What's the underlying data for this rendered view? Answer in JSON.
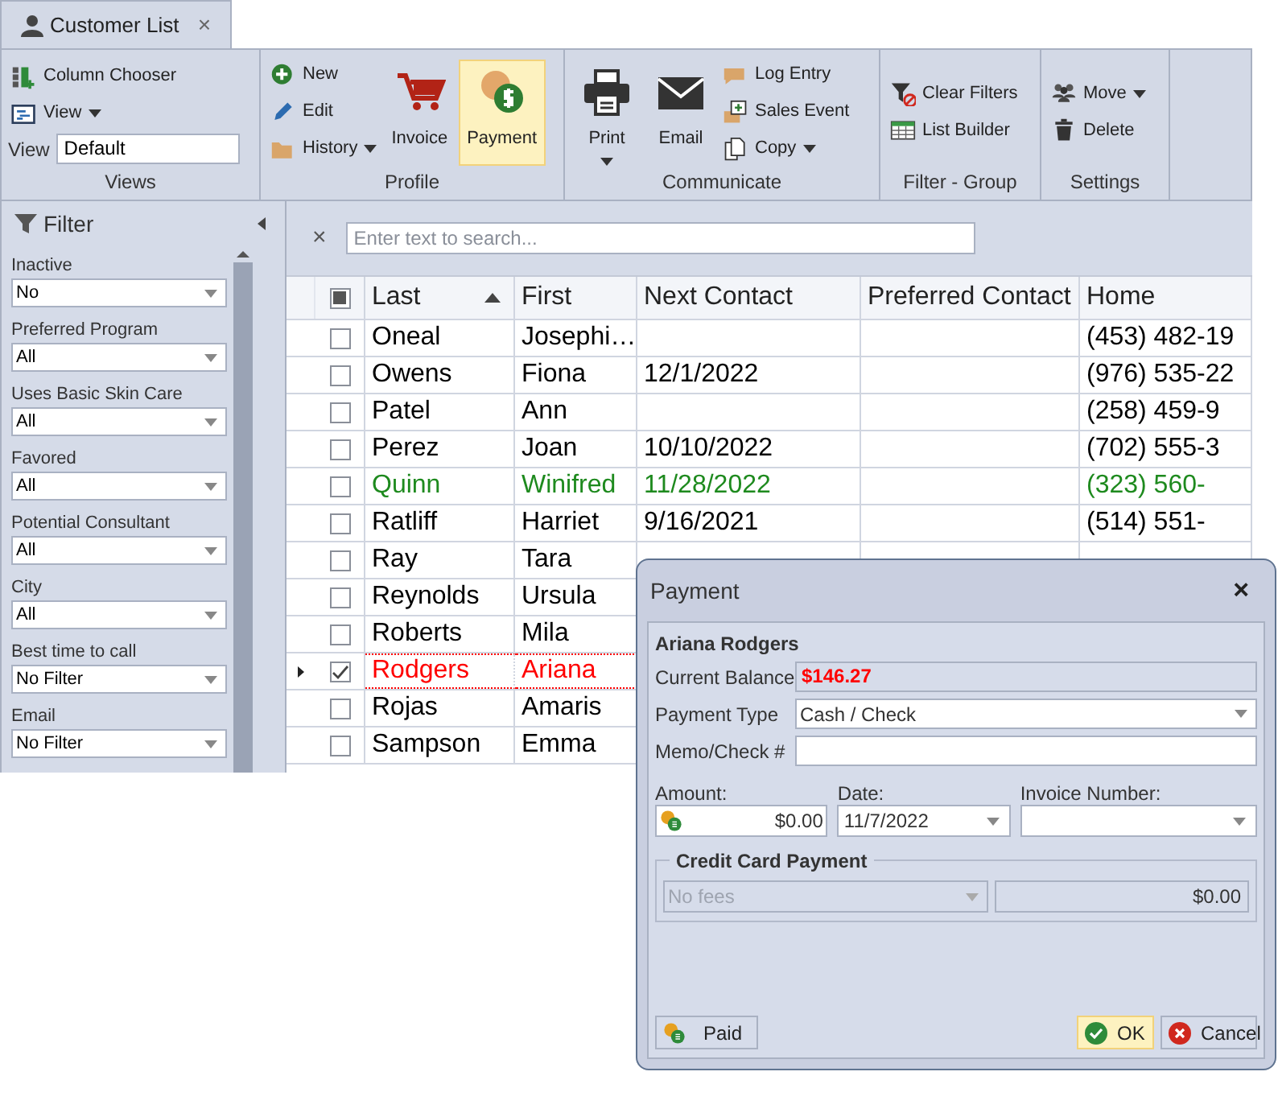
{
  "tab": {
    "title": "Customer List",
    "close": "×"
  },
  "ribbon": {
    "groups": [
      {
        "label": "Views",
        "columns": [
          [
            {
              "kind": "small",
              "label": "Column Chooser",
              "dropdown": false,
              "selected": false
            },
            {
              "kind": "small",
              "label": "View",
              "dropdown": true,
              "selected": false
            },
            {
              "kind": "field",
              "label": "View",
              "value": "Default"
            }
          ]
        ]
      },
      {
        "label": "Profile",
        "columns": [
          [
            {
              "kind": "small",
              "label": "New",
              "dropdown": false,
              "selected": false
            },
            {
              "kind": "small",
              "label": "Edit",
              "dropdown": false,
              "selected": false
            },
            {
              "kind": "small",
              "label": "History",
              "dropdown": true,
              "selected": false
            }
          ],
          [
            {
              "kind": "large",
              "label": "Invoice",
              "dropdown": false,
              "selected": false
            }
          ],
          [
            {
              "kind": "large",
              "label": "Payment",
              "dropdown": false,
              "selected": true
            }
          ]
        ]
      },
      {
        "label": "Communicate",
        "columns": [
          [
            {
              "kind": "large",
              "label": "Print",
              "dropdown": true,
              "selected": false
            }
          ],
          [
            {
              "kind": "large",
              "label": "Email",
              "dropdown": false,
              "selected": false
            }
          ],
          [
            {
              "kind": "small",
              "label": "Log Entry",
              "dropdown": false,
              "selected": false
            },
            {
              "kind": "small",
              "label": "Sales Event",
              "dropdown": false,
              "selected": false
            },
            {
              "kind": "small",
              "label": "Copy",
              "dropdown": true,
              "selected": false
            }
          ]
        ]
      },
      {
        "label": "Filter - Group",
        "columns": [
          [
            {
              "kind": "small",
              "label": "Clear Filters",
              "dropdown": false,
              "selected": false
            },
            {
              "kind": "small",
              "label": "List Builder",
              "dropdown": false,
              "selected": false
            }
          ]
        ]
      },
      {
        "label": "Settings",
        "columns": [
          [
            {
              "kind": "small",
              "label": "Move",
              "dropdown": true,
              "selected": false
            },
            {
              "kind": "small",
              "label": "Delete",
              "dropdown": false,
              "selected": false
            }
          ]
        ]
      }
    ]
  },
  "filter": {
    "title": "Filter",
    "filters": [
      {
        "label": "Inactive",
        "value": "No"
      },
      {
        "label": "Preferred Program",
        "value": "All"
      },
      {
        "label": "Uses Basic Skin Care",
        "value": "All"
      },
      {
        "label": "Favored",
        "value": "All"
      },
      {
        "label": "Potential Consultant",
        "value": "All"
      },
      {
        "label": "City",
        "value": "All"
      },
      {
        "label": "Best time to call",
        "value": "No Filter"
      },
      {
        "label": "Email",
        "value": "No Filter"
      }
    ]
  },
  "grid": {
    "search": {
      "clear": "×",
      "placeholder": "Enter text to search..."
    },
    "select_all": {
      "indeterminate": true
    },
    "columns": [
      {
        "label": "Last",
        "sorted": true
      },
      {
        "label": "First",
        "sorted": false
      },
      {
        "label": "Next Contact",
        "sorted": false
      },
      {
        "label": "Preferred Contact",
        "sorted": false
      },
      {
        "label": "Home",
        "sorted": false
      }
    ],
    "rows": [
      {
        "cells": [
          "Oneal",
          "Josephi…",
          "",
          "",
          "(453) 482-19"
        ],
        "checked": false,
        "selected": false,
        "color": "#000000"
      },
      {
        "cells": [
          "Owens",
          "Fiona",
          "12/1/2022",
          "",
          "(976) 535-22"
        ],
        "checked": false,
        "selected": false,
        "color": "#000000"
      },
      {
        "cells": [
          "Patel",
          "Ann",
          "",
          "",
          "(258) 459-9"
        ],
        "checked": false,
        "selected": false,
        "color": "#000000"
      },
      {
        "cells": [
          "Perez",
          "Joan",
          "10/10/2022",
          "",
          "(702) 555-3"
        ],
        "checked": false,
        "selected": false,
        "color": "#000000"
      },
      {
        "cells": [
          "Quinn",
          "Winifred",
          "11/28/2022",
          "",
          "(323) 560-"
        ],
        "checked": false,
        "selected": false,
        "color": "#1e8a1e"
      },
      {
        "cells": [
          "Ratliff",
          "Harriet",
          "9/16/2021",
          "",
          "(514) 551-"
        ],
        "checked": false,
        "selected": false,
        "color": "#000000"
      },
      {
        "cells": [
          "Ray",
          "Tara"
        ],
        "checked": false,
        "selected": false,
        "color": "#000000"
      },
      {
        "cells": [
          "Reynolds",
          "Ursula"
        ],
        "checked": false,
        "selected": false,
        "color": "#000000"
      },
      {
        "cells": [
          "Roberts",
          "Mila"
        ],
        "checked": false,
        "selected": false,
        "color": "#000000"
      },
      {
        "cells": [
          "Rodgers",
          "Ariana"
        ],
        "checked": true,
        "selected": true,
        "color": "#ff0000"
      },
      {
        "cells": [
          "Rojas",
          "Amaris"
        ],
        "checked": false,
        "selected": false,
        "color": "#000000"
      },
      {
        "cells": [
          "Sampson",
          "Emma"
        ],
        "checked": false,
        "selected": false,
        "color": "#000000"
      }
    ]
  },
  "dialog": {
    "title": "Payment",
    "close": "×",
    "customer": "Ariana Rodgers",
    "current_balance": {
      "label": "Current Balance",
      "value": "$146.27"
    },
    "payment_type": {
      "label": "Payment Type",
      "value": "Cash / Check"
    },
    "memo": {
      "label": "Memo/Check #"
    },
    "amount": {
      "label": "Amount:",
      "value": "$0.00"
    },
    "date": {
      "label": "Date:",
      "value": "11/7/2022"
    },
    "invoice_number": {
      "label": "Invoice Number:"
    },
    "credit_card": {
      "title": "Credit Card Payment",
      "fees": {
        "value": "No fees",
        "disabled": true
      },
      "amount": {
        "value": "$0.00",
        "disabled": true
      }
    },
    "buttons": [
      {
        "kind": "paid",
        "label": "Paid",
        "selected": false
      },
      {
        "kind": "ok",
        "label": "OK",
        "selected": true
      },
      {
        "kind": "cancel",
        "label": "Cancel",
        "selected": false
      }
    ]
  }
}
